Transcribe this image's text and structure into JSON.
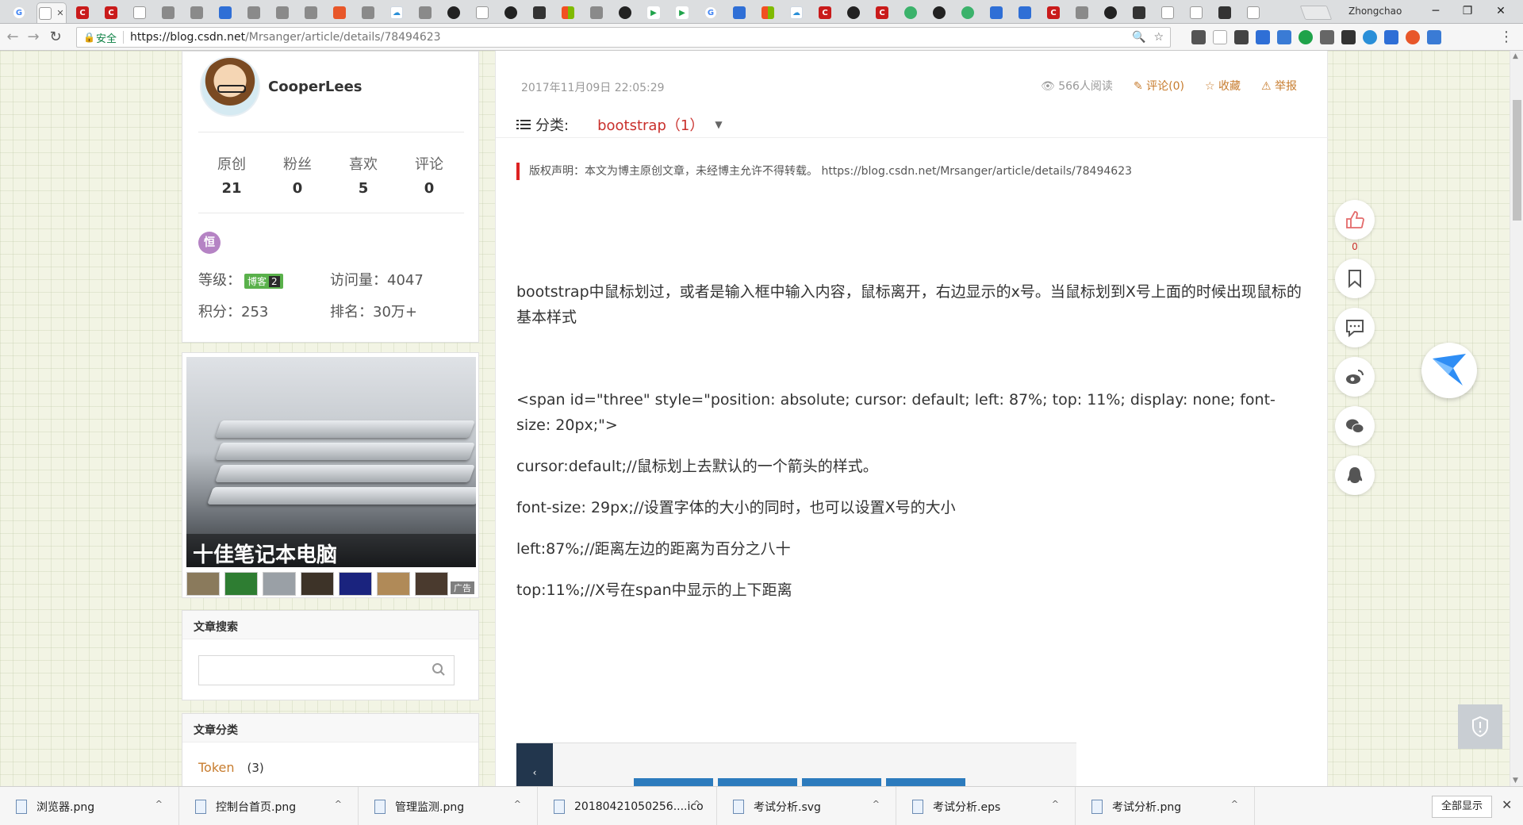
{
  "browser": {
    "profile_name": "Zhongchao",
    "secure_label": "安全",
    "url_host": "https://blog.csdn.net",
    "url_path": "/Mrsanger/article/details/78494623",
    "tabs": [
      "g",
      "active",
      "c",
      "c",
      "doc",
      "misc",
      "misc",
      "blue",
      "misc",
      "misc",
      "misc",
      "orange",
      "misc",
      "cloud",
      "misc",
      "gh",
      "doc",
      "gh",
      "dark",
      "ms",
      "misc",
      "gh",
      "play",
      "play",
      "g",
      "blue",
      "ms",
      "cloud",
      "c",
      "gh",
      "c",
      "green",
      "gh",
      "green",
      "blue",
      "blue",
      "c",
      "misc",
      "gh",
      "dark",
      "doc",
      "doc",
      "dark",
      "doc"
    ],
    "window_controls": {
      "minimize": "─",
      "maximize": "❐",
      "close": "✕"
    }
  },
  "profile": {
    "username": "CooperLees",
    "stats": [
      {
        "label": "原创",
        "value": "21"
      },
      {
        "label": "粉丝",
        "value": "0"
      },
      {
        "label": "喜欢",
        "value": "5"
      },
      {
        "label": "评论",
        "value": "0"
      }
    ],
    "medal": "恒",
    "level_label": "等级：",
    "level_badge": "博客",
    "level_num": "2",
    "visits_label": "访问量：",
    "visits": "4047",
    "points_label": "积分：",
    "points": "253",
    "rank_label": "排名：",
    "rank": "30万+"
  },
  "ad": {
    "title": "十佳笔记本电脑",
    "mark": "广告"
  },
  "search": {
    "header": "文章搜索",
    "placeholder": ""
  },
  "categories": {
    "header": "文章分类",
    "items": [
      {
        "name": "Token",
        "count": "(3)"
      }
    ]
  },
  "article": {
    "date": "2017年11月09日 22:05:29",
    "views": "566人阅读",
    "comments": "评论(0)",
    "favorite": "收藏",
    "report": "举报",
    "category_label": "分类:",
    "category_value": "bootstrap（1）",
    "copyright": "版权声明：本文为博主原创文章，未经博主允许不得转载。 https://blog.csdn.net/Mrsanger/article/details/78494623",
    "paragraphs": [
      "bootstrap中鼠标划过，或者是输入框中输入内容，鼠标离开，右边显示的x号。当鼠标划到X号上面的时候出现鼠标的基本样式",
      "<span id=\"three\" style=\"position: absolute; cursor: default; left: 87%; top: 11%; display: none; font-size: 20px;\">",
      "cursor:default;//鼠标划上去默认的一个箭头的样式。",
      "font-size: 29px;//设置字体的大小的同时，也可以设置X号的大小",
      "left:87%;//距离左边的距离为百分之八十",
      "top:11%;//X号在span中显示的上下距离"
    ]
  },
  "float": {
    "like_count": "0"
  },
  "downloads": {
    "items": [
      "浏览器.png",
      "控制台首页.png",
      "管理监测.png",
      "20180421050256....ico",
      "考试分析.svg",
      "考试分析.eps",
      "考试分析.png"
    ],
    "show_all": "全部显示"
  }
}
